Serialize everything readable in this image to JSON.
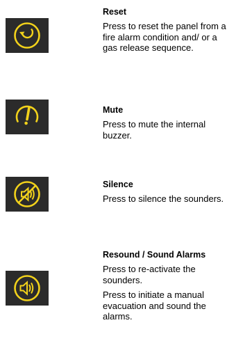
{
  "accent_color": "#f2d21b",
  "button_background": "#2b2b2b",
  "entries": [
    {
      "icon": "reset-icon",
      "title": "Reset",
      "paragraphs": [
        "Press to reset the panel from a fire alarm condition and/ or a gas release sequence."
      ]
    },
    {
      "icon": "mute-icon",
      "title": "Mute",
      "paragraphs": [
        "Press to mute the internal buzzer."
      ]
    },
    {
      "icon": "silence-icon",
      "title": "Silence",
      "paragraphs": [
        "Press to silence the sounders."
      ]
    },
    {
      "icon": "resound-icon",
      "title": "Resound / Sound Alarms",
      "paragraphs": [
        "Press to re-activate the sounders.",
        "Press to initiate a manual evacuation and sound the alarms."
      ]
    }
  ]
}
